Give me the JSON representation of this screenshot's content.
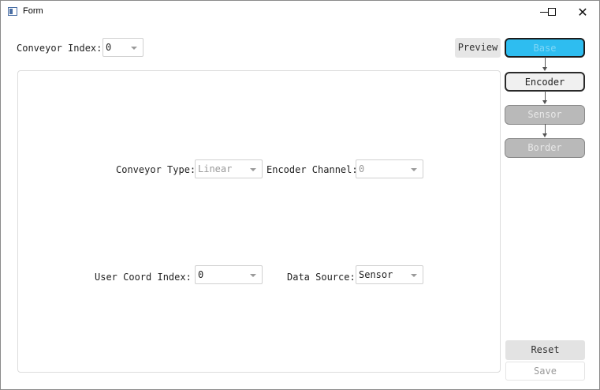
{
  "window": {
    "title": "Form",
    "close_glyph": "✕"
  },
  "top": {
    "conveyor_index_label": "Conveyor Index:",
    "conveyor_index_value": "0",
    "preview_label": "Preview"
  },
  "form": {
    "conveyor_type_label": "Conveyor Type:",
    "conveyor_type_value": "Linear",
    "encoder_channel_label": "Encoder Channel:",
    "encoder_channel_value": "0",
    "user_coord_index_label": "User Coord Index:",
    "user_coord_index_value": "0",
    "data_source_label": "Data Source:",
    "data_source_value": "Sensor"
  },
  "steps": {
    "base": "Base",
    "encoder": "Encoder",
    "sensor": "Sensor",
    "border": "Border"
  },
  "actions": {
    "reset_label": "Reset",
    "save_label": "Save"
  },
  "colors": {
    "accent": "#2ebdf0",
    "disabled_step": "#b9b9b9"
  }
}
